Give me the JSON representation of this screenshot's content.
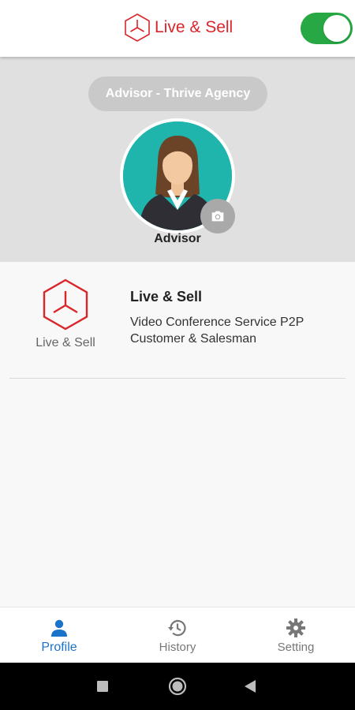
{
  "header": {
    "brand_text": "Live & Sell",
    "brand_color": "#d9262b",
    "logo_icon": "tri-hexagon-logo-icon",
    "toggle_state": "on",
    "toggle_color": "#28a745"
  },
  "profile": {
    "role_label": "Advisor - Thrive Agency",
    "avatar_icon": "businesswoman-avatar-icon",
    "camera_icon": "camera-icon",
    "name": "Advisor",
    "avatar_bg": "#1fb5ad"
  },
  "app_info": {
    "logo_text": "Live & Sell",
    "title": "Live & Sell",
    "description": "Video Conference Service P2P Customer & Salesman"
  },
  "bottom_nav": {
    "accent_color": "#1a73c8",
    "items": [
      {
        "label": "Profile",
        "icon": "person-icon",
        "active": true
      },
      {
        "label": "History",
        "icon": "history-icon",
        "active": false
      },
      {
        "label": "Setting",
        "icon": "gear-icon",
        "active": false
      }
    ]
  },
  "system_nav": {
    "buttons": [
      "recent-apps-icon",
      "home-icon",
      "back-icon"
    ]
  }
}
